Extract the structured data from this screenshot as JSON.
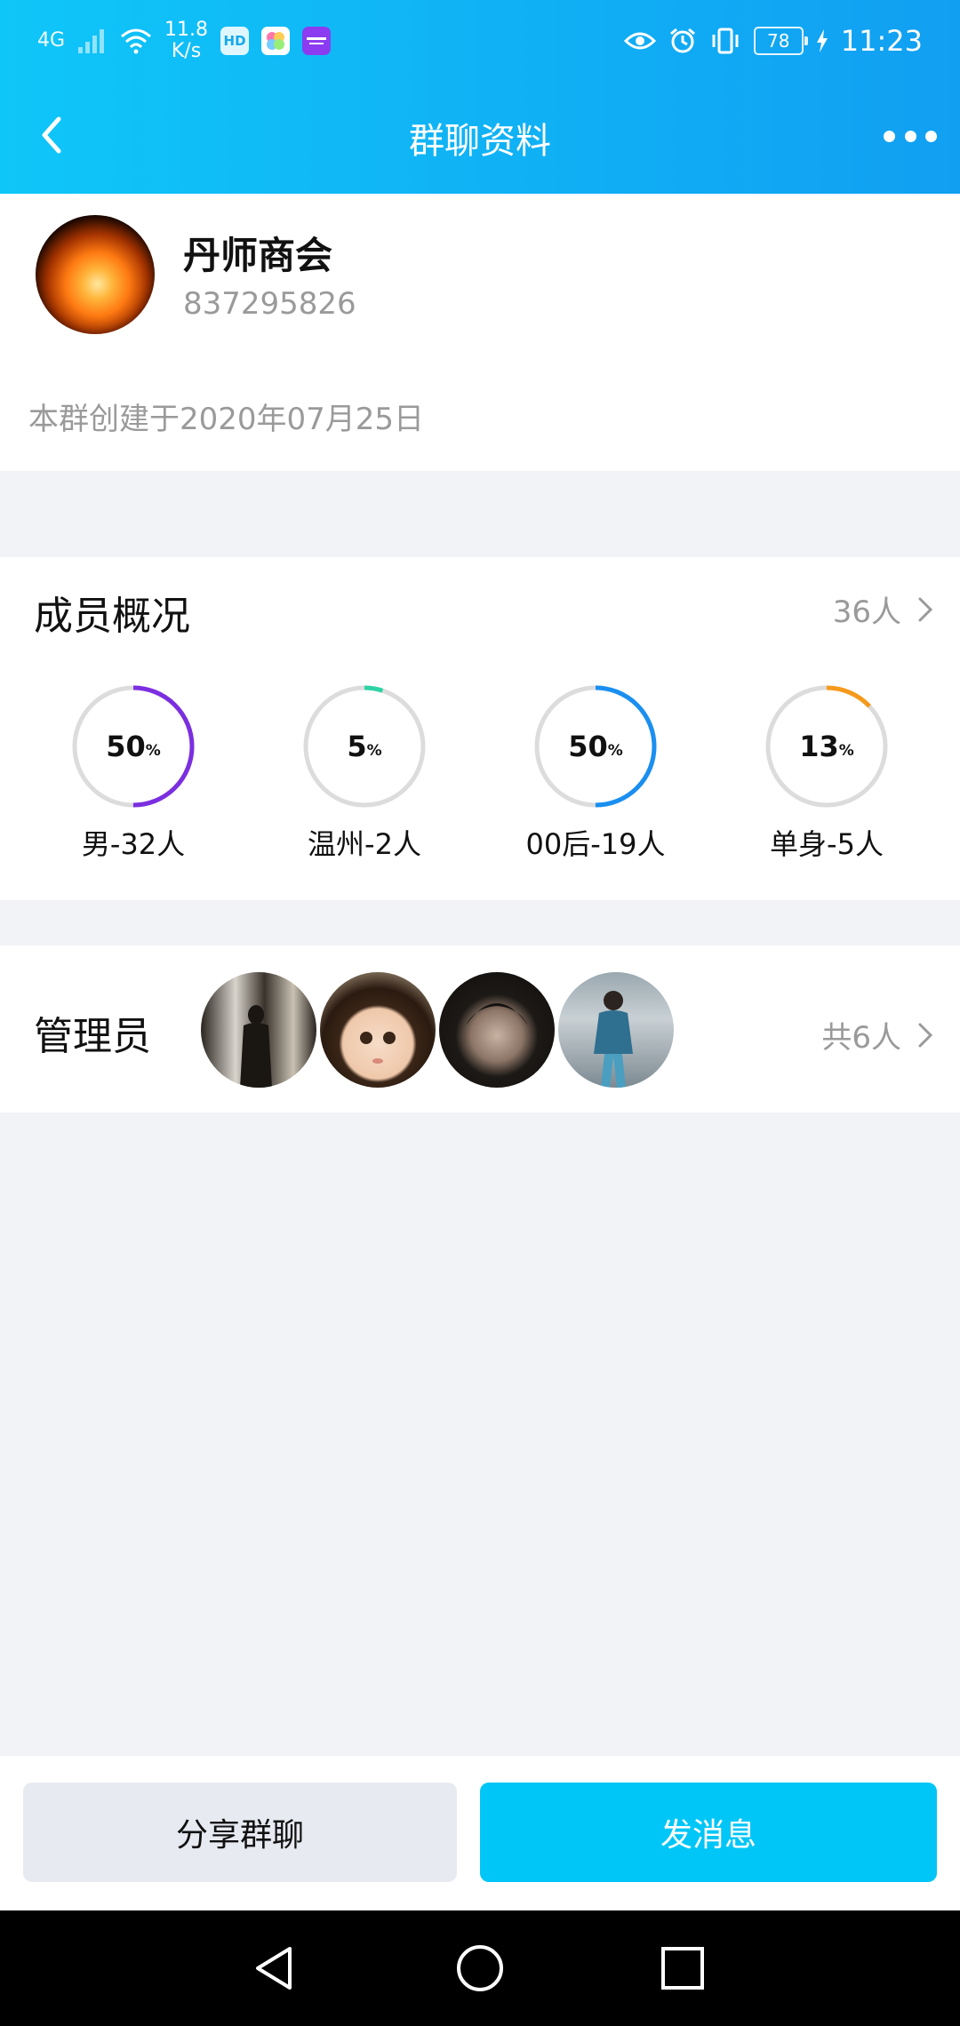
{
  "status_bar": {
    "network": "4G",
    "speed_value": "11.8",
    "speed_unit": "K/s",
    "hd_badge": "HD",
    "battery": "78",
    "time": "11:23"
  },
  "header": {
    "title": "群聊资料"
  },
  "group": {
    "name": "丹师商会",
    "id": "837295826",
    "created": "本群创建于2020年07月25日"
  },
  "members": {
    "title": "成员概况",
    "count": "36人",
    "stats": [
      {
        "value": "50",
        "unit": "%",
        "label": "男-32人",
        "percent": 50,
        "color": "#7b2fe0"
      },
      {
        "value": "5",
        "unit": "%",
        "label": "温州-2人",
        "percent": 5,
        "color": "#2ed3a5"
      },
      {
        "value": "50",
        "unit": "%",
        "label": "00后-19人",
        "percent": 50,
        "color": "#1a8ff0"
      },
      {
        "value": "13",
        "unit": "%",
        "label": "单身-5人",
        "percent": 13,
        "color": "#f59a1b"
      }
    ]
  },
  "admins": {
    "title": "管理员",
    "count": "共6人"
  },
  "actions": {
    "share": "分享群聊",
    "send": "发消息"
  },
  "icons": {
    "back": "chevron-left-icon",
    "more": "more-dots-icon",
    "nav_back": "triangle-back-icon",
    "nav_home": "circle-home-icon",
    "nav_recent": "square-recent-icon"
  }
}
